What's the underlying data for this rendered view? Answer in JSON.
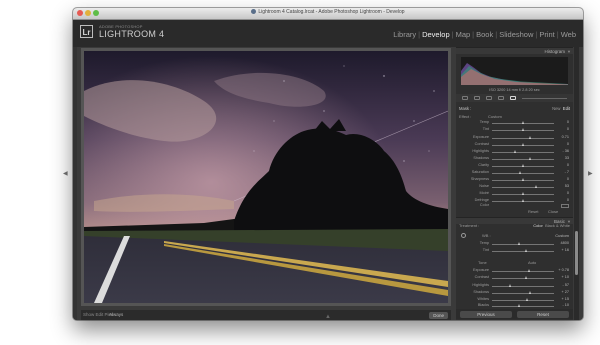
{
  "window": {
    "title": "Lightroom 4 Catalog.lrcat - Adobe Photoshop Lightroom - Develop"
  },
  "app": {
    "logo": "Lr",
    "subtitle": "ADOBE PHOTOSHOP",
    "name": "LIGHTROOM 4"
  },
  "modules": [
    "Library",
    "Develop",
    "Map",
    "Book",
    "Slideshow",
    "Print",
    "Web"
  ],
  "active_module": "Develop",
  "photo": {
    "description": "Night sky with stars and milky way over a road and silhouetted trees"
  },
  "statusbar": {
    "label": "Show Edit Pins :",
    "value": "Always",
    "done": "Done"
  },
  "panel": {
    "histogram_title": "Histogram",
    "histogram_readout": "ISO 3200   14 mm   f/ 2.8   20 sec",
    "mask_label": "Mask :",
    "mask_mode_new": "New",
    "mask_mode_edit": "Edit",
    "effect_label": "Effect :",
    "effect_value": "Custom",
    "sliders": [
      {
        "label": "Temp",
        "value": "0",
        "pos": 0.5
      },
      {
        "label": "Tint",
        "value": "0",
        "pos": 0.5
      },
      {
        "label": "Exposure",
        "value": "0.71",
        "pos": 0.62
      },
      {
        "label": "Contrast",
        "value": "0",
        "pos": 0.5
      },
      {
        "label": "Highlights",
        "value": "- 36",
        "pos": 0.38
      },
      {
        "label": "Shadows",
        "value": "33",
        "pos": 0.62
      },
      {
        "label": "Clarity",
        "value": "0",
        "pos": 0.5
      },
      {
        "label": "Saturation",
        "value": "- 7",
        "pos": 0.46
      },
      {
        "label": "Sharpness",
        "value": "0",
        "pos": 0.5
      },
      {
        "label": "Noise",
        "value": "53",
        "pos": 0.72
      },
      {
        "label": "Moiré",
        "value": "0",
        "pos": 0.5
      },
      {
        "label": "Defringe",
        "value": "0",
        "pos": 0.5
      },
      {
        "label": "Color",
        "value": "",
        "pos": 0.5
      }
    ],
    "reset_label": "Reset",
    "close_label": "Close",
    "basic_title": "Basic",
    "treatment_label": "Treatment :",
    "treatment_color": "Color",
    "treatment_bw": "Black & White",
    "wb_label": "WB :",
    "wb_value": "Custom",
    "basic_sliders_top": [
      {
        "label": "Temp",
        "value": "4800",
        "pos": 0.45
      },
      {
        "label": "Tint",
        "value": "+ 16",
        "pos": 0.55
      }
    ],
    "tone_label": "Tone",
    "tone_auto": "Auto",
    "basic_sliders_bottom": [
      {
        "label": "Exposure",
        "value": "+ 0.78",
        "pos": 0.6
      },
      {
        "label": "Contrast",
        "value": "+ 10",
        "pos": 0.55
      },
      {
        "label": "Highlights",
        "value": "- 57",
        "pos": 0.3
      },
      {
        "label": "Shadows",
        "value": "+ 27",
        "pos": 0.62
      },
      {
        "label": "Whites",
        "value": "+ 15",
        "pos": 0.57
      },
      {
        "label": "Blacks",
        "value": "- 10",
        "pos": 0.45
      }
    ],
    "previous": "Previous",
    "reset": "Reset"
  },
  "colors": {
    "accent": "#f0f0f0",
    "panel_bg": "#2f2f2f",
    "window_bg": "#3b3b3b"
  }
}
